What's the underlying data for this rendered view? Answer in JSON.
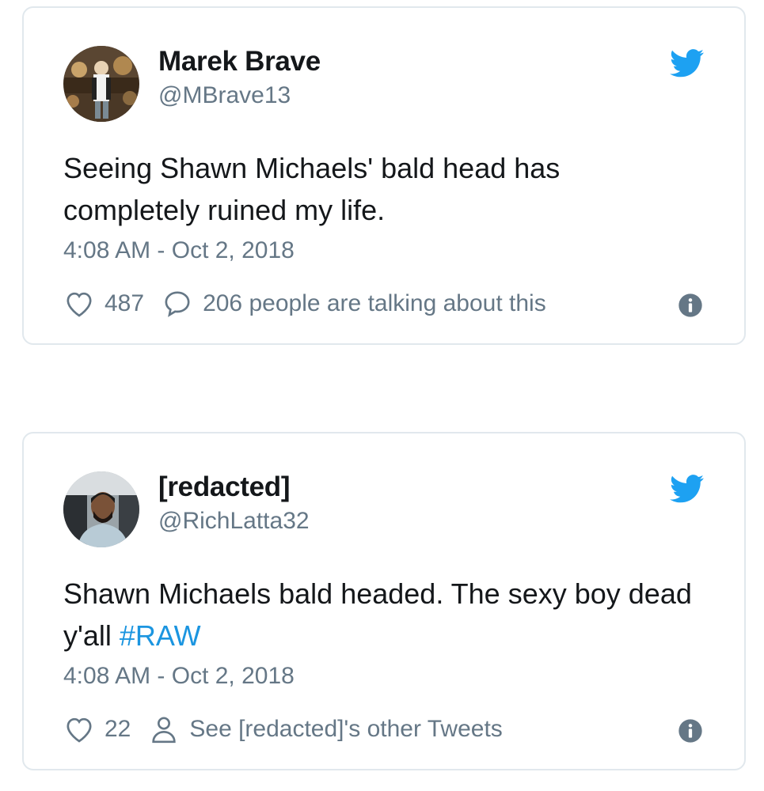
{
  "tweets": [
    {
      "name": "Marek Brave",
      "handle": "@MBrave13",
      "text": "Seeing Shawn Michaels' bald head has completely ruined my life.",
      "hashtag": "",
      "timestamp": "4:08 AM - Oct 2, 2018",
      "likes": "487",
      "secondary_action_icon": "speech-bubble-icon",
      "secondary_action_text": "206 people are talking about this"
    },
    {
      "name": "[redacted]",
      "handle": "@RichLatta32",
      "text": "Shawn Michaels bald headed. The sexy boy dead y'all ",
      "hashtag": "#RAW",
      "timestamp": "4:08 AM - Oct 2, 2018",
      "likes": "22",
      "secondary_action_icon": "person-icon",
      "secondary_action_text": "See [redacted]'s other Tweets"
    }
  ],
  "colors": {
    "twitter_blue": "#1da1f2",
    "hashtag": "#1b95e0",
    "secondary_text": "#657786",
    "border": "#e1e8ed"
  }
}
